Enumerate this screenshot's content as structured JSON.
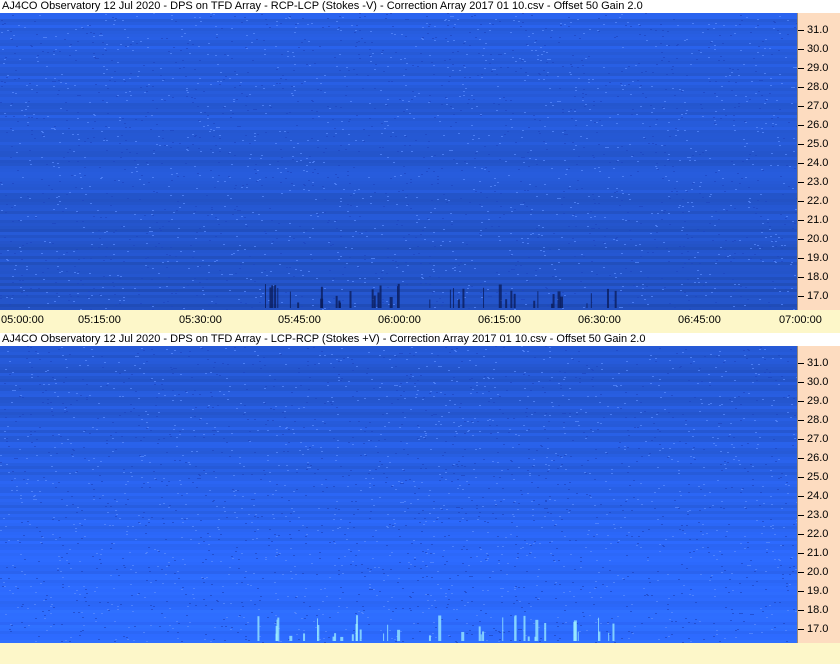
{
  "panels": [
    {
      "title": "AJ4CO Observatory 12 Jul 2020  -  DPS on TFD Array  -  RCP-LCP (Stokes -V)  -  Correction Array 2017 01 10.csv  -  Offset 50  Gain 2.0",
      "freq_labels": [
        "31.0",
        "30.0",
        "29.0",
        "28.0",
        "27.0",
        "26.0",
        "25.0",
        "24.0",
        "23.0",
        "22.0",
        "21.0",
        "20.0",
        "19.0",
        "18.0",
        "17.0"
      ],
      "time_labels": [
        "05:00:00",
        "05:15:00",
        "05:30:00",
        "05:45:00",
        "06:00:00",
        "06:15:00",
        "06:30:00",
        "06:45:00",
        "07:00:00"
      ],
      "burst_color": "#0a1a55"
    },
    {
      "title": "AJ4CO Observatory 12 Jul 2020  -  DPS on TFD Array  -  LCP-RCP (Stokes +V)  -  Correction Array 2017 01 10.csv  -  Offset 50  Gain 2.0",
      "freq_labels": [
        "31.0",
        "30.0",
        "29.0",
        "28.0",
        "27.0",
        "26.0",
        "25.0",
        "24.0",
        "23.0",
        "22.0",
        "21.0",
        "20.0",
        "19.0",
        "18.0",
        "17.0"
      ],
      "time_labels": [],
      "burst_color": "#9ff0ff"
    }
  ],
  "colors": {
    "spectrogram_base": "#2f63e6",
    "axis_background": "#fddcc0",
    "time_axis_background": "#fdf7c9"
  }
}
